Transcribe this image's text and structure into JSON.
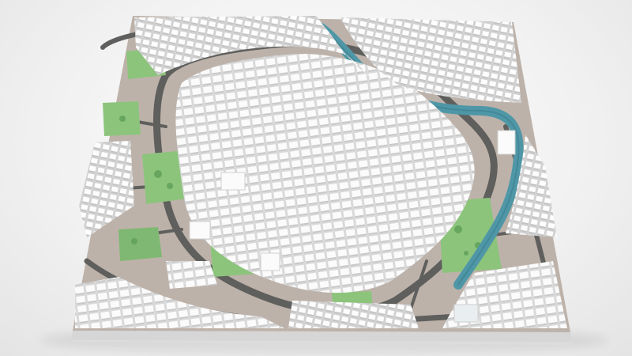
{
  "scene": {
    "subject": "",
    "colors": {
      "background": "#efefef",
      "base_side": "#e6e6e6",
      "base_front": "#dcdcdc",
      "ground": "#b9aea6",
      "street": "#5f5f5d",
      "street_light": "#7a7a76",
      "park": "#8cc47c",
      "park_dark": "#6fae63",
      "water": "#4f97a7",
      "building": "#fbfbfb",
      "building_shade": "#d8d8d8"
    },
    "icons": [
      "river",
      "park",
      "building-block",
      "road"
    ]
  }
}
